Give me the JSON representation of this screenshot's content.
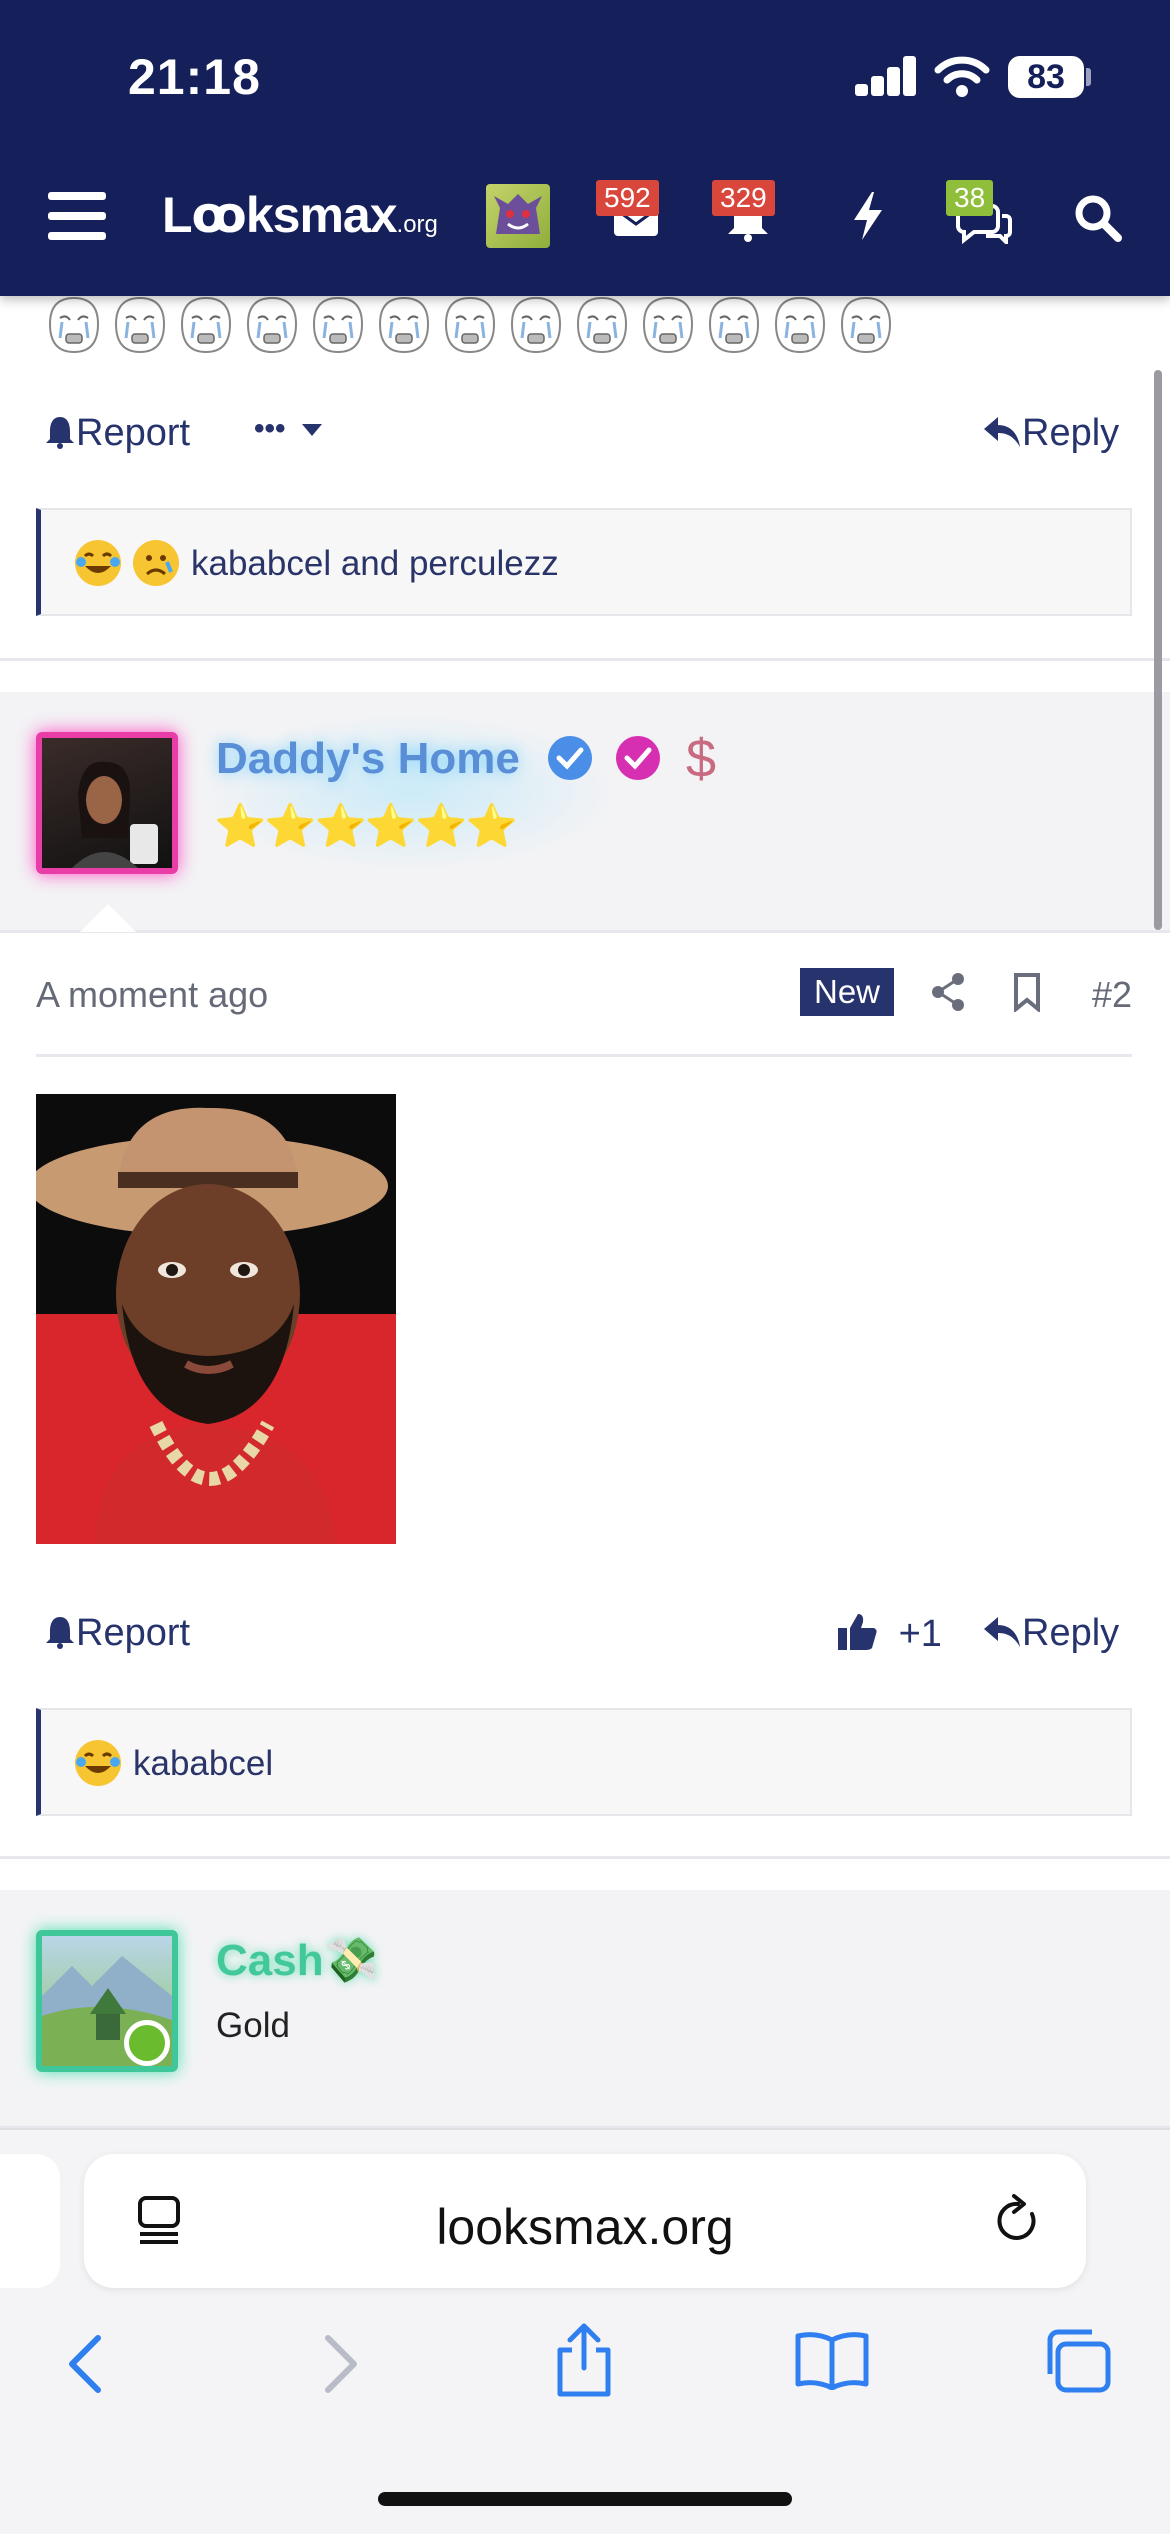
{
  "status_bar": {
    "time": "21:18",
    "battery": "83"
  },
  "header": {
    "logo_main": "Lꝏksmax",
    "logo_suffix": ".org",
    "badges": {
      "inbox": "592",
      "alerts": "329",
      "chats": "38"
    },
    "colors": {
      "bar": "#15205a",
      "badge_red": "#d9463b",
      "badge_green": "#8fbf3a"
    }
  },
  "post1": {
    "report_label": "Report",
    "more_label": "•••",
    "reply_label": "Reply",
    "reactions_text": "kababcel and perculezz"
  },
  "post2": {
    "username": "Daddy's Home",
    "timestamp": "A moment ago",
    "new_badge": "New",
    "post_number": "#2",
    "report_label": "Report",
    "like_label": "+1",
    "reply_label": "Reply",
    "reactions_text": "kababcel",
    "stars": "⭐⭐⭐⭐⭐⭐",
    "dollar": "$"
  },
  "post3": {
    "username": "Cash",
    "username_emoji": "💸",
    "rank": "Gold"
  },
  "browser": {
    "url": "looksmax.org"
  }
}
